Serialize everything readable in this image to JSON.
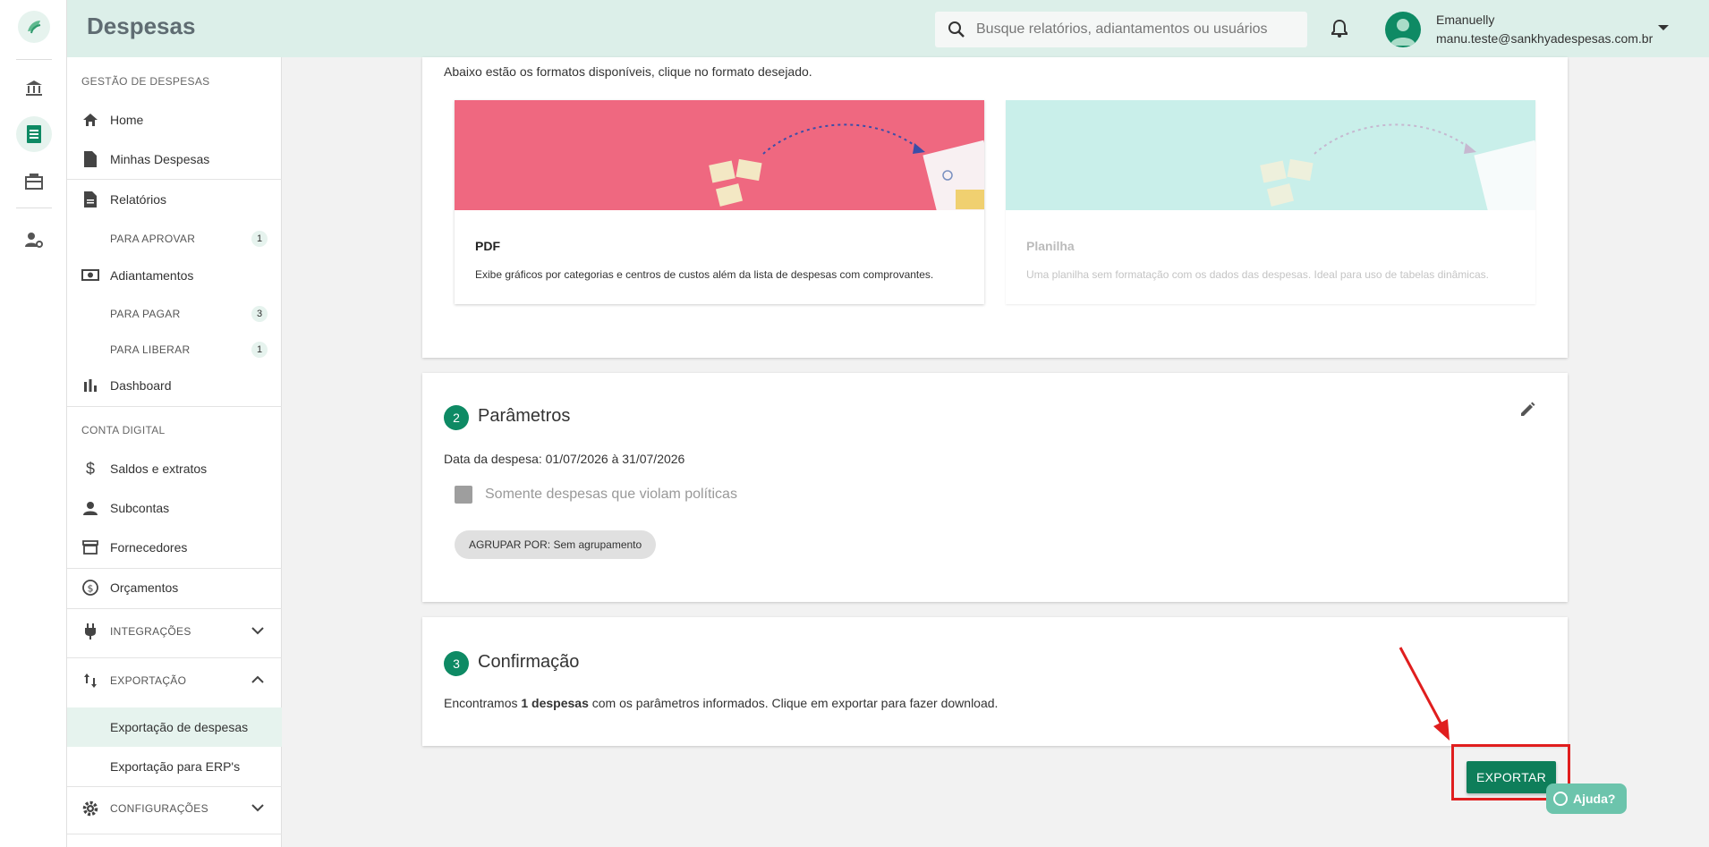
{
  "header": {
    "title": "Despesas",
    "search_placeholder": "Busque relatórios, adiantamentos ou usuários",
    "user_name": "Emanuelly",
    "user_email": "manu.teste@sankhyadespesas.com.br"
  },
  "sidebar": {
    "section1": "GESTÃO DE DESPESAS",
    "home": "Home",
    "minhas_despesas": "Minhas Despesas",
    "relatorios": "Relatórios",
    "para_aprovar": "PARA APROVAR",
    "para_aprovar_count": "1",
    "adiantamentos": "Adiantamentos",
    "para_pagar": "PARA PAGAR",
    "para_pagar_count": "3",
    "para_liberar": "PARA LIBERAR",
    "para_liberar_count": "1",
    "dashboard": "Dashboard",
    "section2": "CONTA DIGITAL",
    "saldos": "Saldos e extratos",
    "subcontas": "Subcontas",
    "fornecedores": "Fornecedores",
    "orcamentos": "Orçamentos",
    "integracoes": "INTEGRAÇÕES",
    "exportacao": "EXPORTAÇÃO",
    "exportacao_despesas": "Exportação de despesas",
    "exportacao_erp": "Exportação para ERP's",
    "configuracoes": "CONFIGURAÇÕES"
  },
  "formats": {
    "intro": "Abaixo estão os formatos disponíveis, clique no formato desejado.",
    "pdf_title": "PDF",
    "pdf_desc": "Exibe gráficos por categorias e centros de custos além da lista de despesas com comprovantes.",
    "sheet_title": "Planilha",
    "sheet_desc": "Uma planilha sem formatação com os dados das despesas. Ideal para uso de tabelas dinâmicas."
  },
  "params": {
    "step": "2",
    "title": "Parâmetros",
    "date_text": "Data da despesa: 01/07/2026 à 31/07/2026",
    "checkbox_label": "Somente despesas que violam políticas",
    "chip": "AGRUPAR POR: Sem agrupamento"
  },
  "confirm": {
    "step": "3",
    "title": "Confirmação",
    "text_pre": "Encontramos ",
    "text_bold": "1 despesas",
    "text_post": " com os parâmetros informados. Clique em exportar para fazer download."
  },
  "actions": {
    "export": "EXPORTAR",
    "help": "Ajuda?"
  },
  "colors": {
    "primary": "#0e8a64",
    "header_bg": "#dcefe9",
    "pdf_banner": "#ef6880",
    "sheet_banner": "#c9efea",
    "highlight": "#e01e1e"
  }
}
